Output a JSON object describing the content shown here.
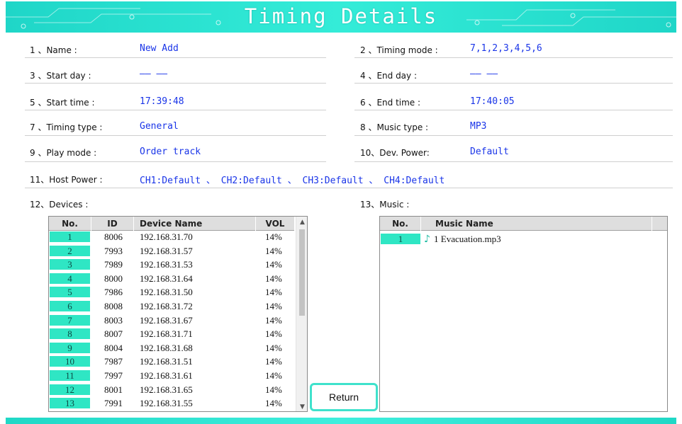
{
  "header": {
    "title": "Timing Details"
  },
  "fields": {
    "name": {
      "label": "1 、Name    :",
      "value": "New Add"
    },
    "timing_mode": {
      "label": "2 、Timing mode  :",
      "value": "7,1,2,3,4,5,6"
    },
    "start_day": {
      "label": "3 、Start day  :",
      "value": "—— ——"
    },
    "end_day": {
      "label": "4 、End day  :",
      "value": "—— ——"
    },
    "start_time": {
      "label": "5 、Start time  :",
      "value": "17:39:48"
    },
    "end_time": {
      "label": "6 、End time  :",
      "value": "17:40:05"
    },
    "timing_type": {
      "label": "7 、Timing type  :",
      "value": "General"
    },
    "music_type": {
      "label": "8 、Music type  :",
      "value": "MP3"
    },
    "play_mode": {
      "label": "9 、Play mode  :",
      "value": "Order track"
    },
    "dev_power": {
      "label": "10、Dev. Power:",
      "value": "Default"
    },
    "host_power": {
      "label": "11、Host Power  :",
      "value": "CH1:Default 、 CH2:Default 、 CH3:Default 、 CH4:Default"
    },
    "devices": {
      "label": "12、Devices  :"
    },
    "music": {
      "label": "13、Music  :"
    }
  },
  "devices_table": {
    "columns": [
      "No.",
      "ID",
      "Device Name",
      "VOL"
    ],
    "rows": [
      {
        "no": "1",
        "id": "8006",
        "name": "192.168.31.70",
        "vol": "14%"
      },
      {
        "no": "2",
        "id": "7993",
        "name": "192.168.31.57",
        "vol": "14%"
      },
      {
        "no": "3",
        "id": "7989",
        "name": "192.168.31.53",
        "vol": "14%"
      },
      {
        "no": "4",
        "id": "8000",
        "name": "192.168.31.64",
        "vol": "14%"
      },
      {
        "no": "5",
        "id": "7986",
        "name": "192.168.31.50",
        "vol": "14%"
      },
      {
        "no": "6",
        "id": "8008",
        "name": "192.168.31.72",
        "vol": "14%"
      },
      {
        "no": "7",
        "id": "8003",
        "name": "192.168.31.67",
        "vol": "14%"
      },
      {
        "no": "8",
        "id": "8007",
        "name": "192.168.31.71",
        "vol": "14%"
      },
      {
        "no": "9",
        "id": "8004",
        "name": "192.168.31.68",
        "vol": "14%"
      },
      {
        "no": "10",
        "id": "7987",
        "name": "192.168.31.51",
        "vol": "14%"
      },
      {
        "no": "11",
        "id": "7997",
        "name": "192.168.31.61",
        "vol": "14%"
      },
      {
        "no": "12",
        "id": "8001",
        "name": "192.168.31.65",
        "vol": "14%"
      },
      {
        "no": "13",
        "id": "7991",
        "name": "192.168.31.55",
        "vol": "14%"
      }
    ]
  },
  "music_table": {
    "columns": [
      "No.",
      "Music Name"
    ],
    "rows": [
      {
        "no": "1",
        "name": "1 Evacuation.mp3"
      }
    ]
  },
  "buttons": {
    "return_label": "Return"
  },
  "icons": {
    "scroll_up": "chevron-up-icon",
    "scroll_down": "chevron-down-icon",
    "music": "music-note-icon"
  },
  "colors": {
    "accent": "#2fe6c4",
    "value_text": "#1a35e8",
    "header": "#1fd6c8"
  }
}
